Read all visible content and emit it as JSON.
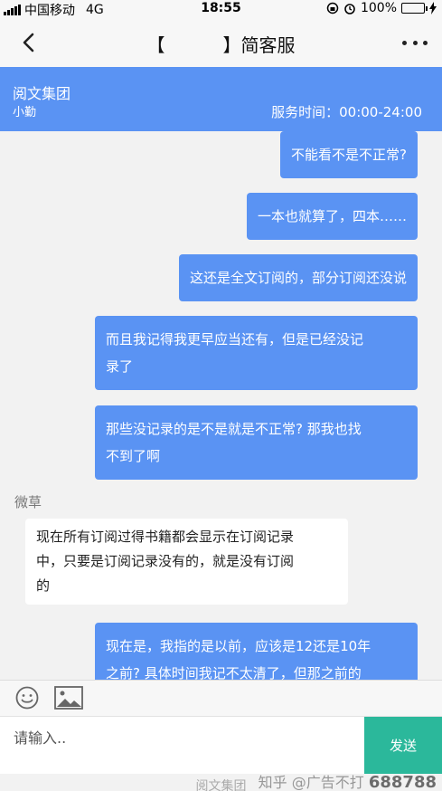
{
  "status_bar": {
    "carrier": "中国移动",
    "network": "4G",
    "time": "18:55",
    "battery": "100%"
  },
  "nav": {
    "title_left_bracket": "【",
    "title_right": "】简客服"
  },
  "service": {
    "company": "阅文集团",
    "agent": "小勤",
    "hours": "服务时间：00:00-24:00"
  },
  "messages": [
    {
      "side": "user",
      "lines": [
        "不能看不是不正常?"
      ]
    },
    {
      "side": "user",
      "lines": [
        "一本也就算了，四本……"
      ]
    },
    {
      "side": "user",
      "lines": [
        "这还是全文订阅的，部分订阅还没说"
      ]
    },
    {
      "side": "user",
      "lines": [
        "而且我记得我更早应当还有，但是已经没记",
        "录了"
      ]
    },
    {
      "side": "user",
      "lines": [
        "那些没记录的是不是就是不正常? 那我也找",
        "不到了啊"
      ]
    },
    {
      "side": "agent",
      "sender": "微草",
      "lines": [
        "现在所有订阅过得书籍都会显示在订阅记录",
        "中，只要是订阅记录没有的，就是没有订阅",
        "的"
      ]
    },
    {
      "side": "user",
      "lines": [
        "现在是，我指的是以前，应该是12还是10年",
        "之前? 具体时间我记不太清了，但那之前的"
      ]
    }
  ],
  "input": {
    "placeholder": "请输入..",
    "send_label": "发送"
  },
  "footer": {
    "text": "阅文集团"
  },
  "watermark": {
    "prefix": "知乎 @广告不打",
    "number": "688788"
  },
  "colors": {
    "accent_blue": "#5a93f3",
    "send_green": "#2bb89b",
    "battery_green": "#3bcf4a"
  }
}
